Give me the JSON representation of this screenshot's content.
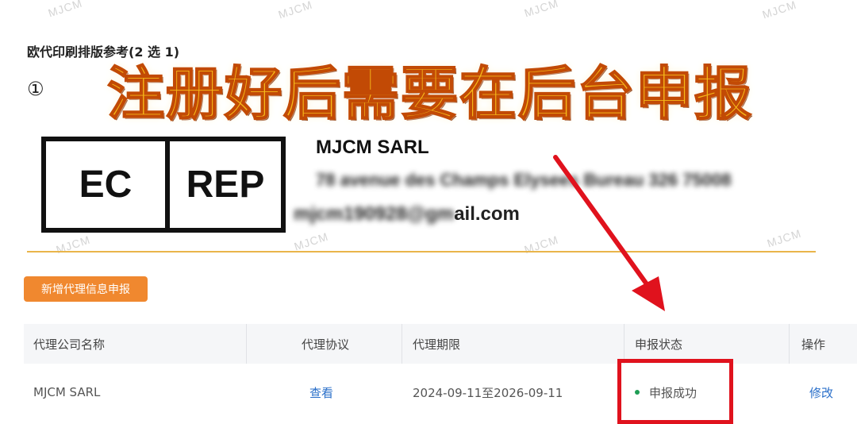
{
  "watermark_text": "MJCM",
  "section_title": "欧代印刷排版参考(2 选 1)",
  "option_number": "①",
  "banner_text": "注册好后需要在后台申报",
  "ecrep_label": {
    "left": "EC",
    "right": "REP"
  },
  "company_info": {
    "name": "MJCM SARL",
    "address": "78 avenue des Champs Elysees Bureau 326 75008",
    "email_blurred": "mjcm190928@gm",
    "email_visible": "ail.com"
  },
  "add_button_label": "新增代理信息申报",
  "table": {
    "headers": {
      "company": "代理公司名称",
      "agreement": "代理协议",
      "period": "代理期限",
      "status": "申报状态",
      "action": "操作"
    },
    "rows": [
      {
        "company": "MJCM SARL",
        "agreement": "查看",
        "period": "2024-09-11至2026-09-11",
        "status": "申报成功",
        "action": "修改"
      }
    ]
  },
  "colors": {
    "accent_orange": "#f0882f",
    "banner_fill": "#f6b91a",
    "annotation_red": "#e0121d",
    "status_green": "#1f9d55",
    "link_blue": "#2a6fc9"
  }
}
